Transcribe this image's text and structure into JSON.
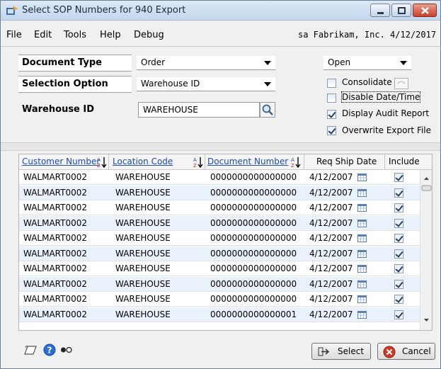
{
  "window": {
    "title": "Select SOP Numbers for 940 Export"
  },
  "menu": {
    "items": [
      "File",
      "Edit",
      "Tools",
      "Help",
      "Debug"
    ]
  },
  "status": {
    "user_company_date": "sa  Fabrikam, Inc.  4/12/2017"
  },
  "form": {
    "document_type_label": "Document Type",
    "document_type_value": "Order",
    "selection_option_label": "Selection Option",
    "selection_option_value": "Warehouse ID",
    "warehouse_id_label": "Warehouse ID",
    "warehouse_id_value": "WAREHOUSE",
    "status_value": "Open",
    "consolidate_label": "Consolidate",
    "consolidate_checked": false,
    "disable_datetime_label": "Disable Date/Time",
    "disable_datetime_checked": false,
    "display_audit_label": "Display Audit Report",
    "display_audit_checked": true,
    "overwrite_label": "Overwrite Export File",
    "overwrite_checked": true
  },
  "grid": {
    "headers": [
      "Customer Number",
      "Location Code",
      "Document Number",
      "Req Ship Date",
      "Include"
    ],
    "rows": [
      [
        "WALMART0002",
        "WAREHOUSE",
        "0000000000000000",
        "4/12/2007"
      ],
      [
        "WALMART0002",
        "WAREHOUSE",
        "0000000000000000",
        "4/12/2007"
      ],
      [
        "WALMART0002",
        "WAREHOUSE",
        "0000000000000000",
        "4/12/2007"
      ],
      [
        "WALMART0002",
        "WAREHOUSE",
        "0000000000000000",
        "4/12/2007"
      ],
      [
        "WALMART0002",
        "WAREHOUSE",
        "0000000000000000",
        "4/12/2007"
      ],
      [
        "WALMART0002",
        "WAREHOUSE",
        "0000000000000000",
        "4/12/2007"
      ],
      [
        "WALMART0002",
        "WAREHOUSE",
        "0000000000000000",
        "4/12/2007"
      ],
      [
        "WALMART0002",
        "WAREHOUSE",
        "0000000000000000",
        "4/12/2007"
      ],
      [
        "WALMART0002",
        "WAREHOUSE",
        "0000000000000000",
        "4/12/2007"
      ],
      [
        "WALMART0002",
        "WAREHOUSE",
        "0000000000000001",
        "4/12/2007"
      ]
    ]
  },
  "buttons": {
    "select": "Select",
    "cancel": "Cancel"
  }
}
